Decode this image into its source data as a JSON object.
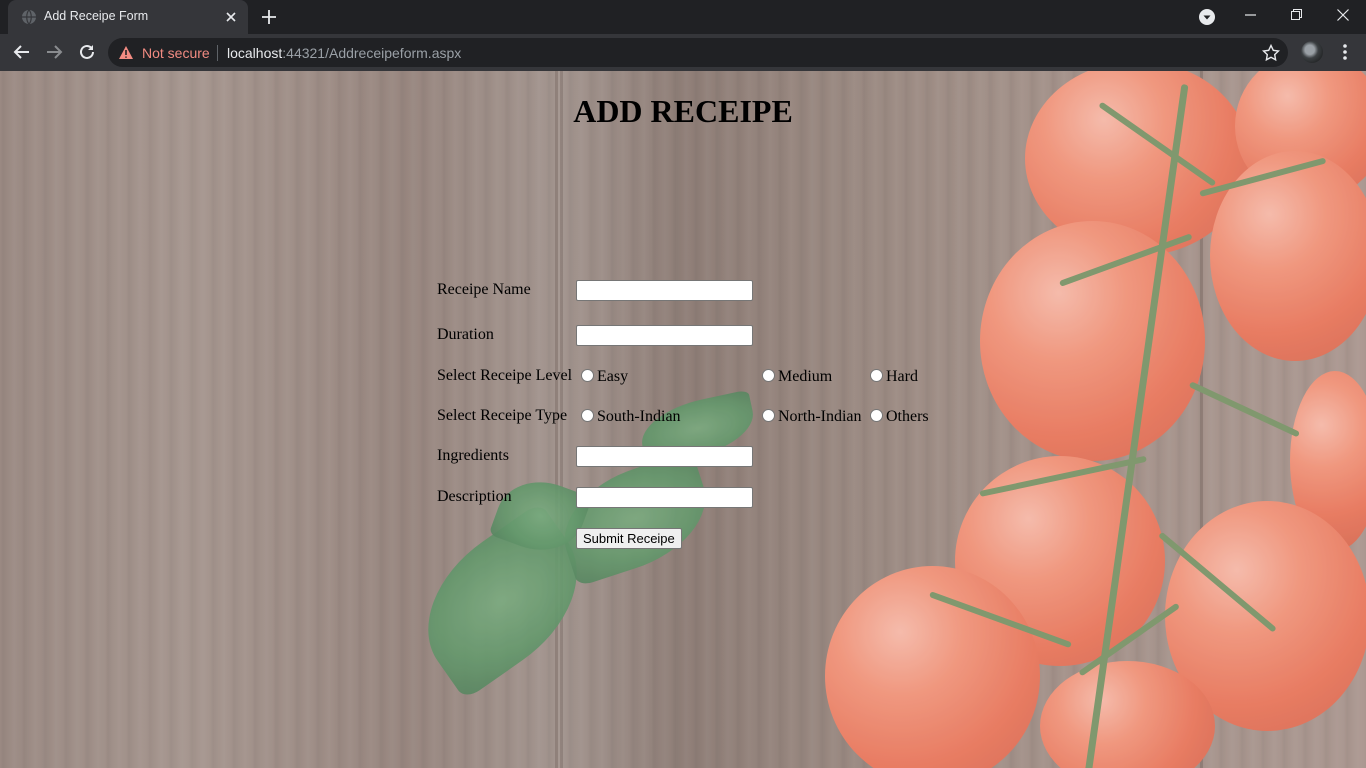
{
  "browser": {
    "tab_title": "Add Receipe Form",
    "security_label": "Not secure",
    "url_host": "localhost",
    "url_rest": ":44321/Addreceipeform.aspx"
  },
  "page": {
    "title": "ADD RECEIPE",
    "fields": {
      "name_label": "Receipe Name",
      "duration_label": "Duration",
      "level_label": "Select Receipe Level",
      "type_label": "Select Receipe Type",
      "ingredients_label": "Ingredients",
      "description_label": "Description"
    },
    "level_options": [
      "Easy",
      "Medium",
      "Hard"
    ],
    "type_options": [
      "South-Indian",
      "North-Indian",
      "Others"
    ],
    "submit_label": "Submit Receipe"
  }
}
